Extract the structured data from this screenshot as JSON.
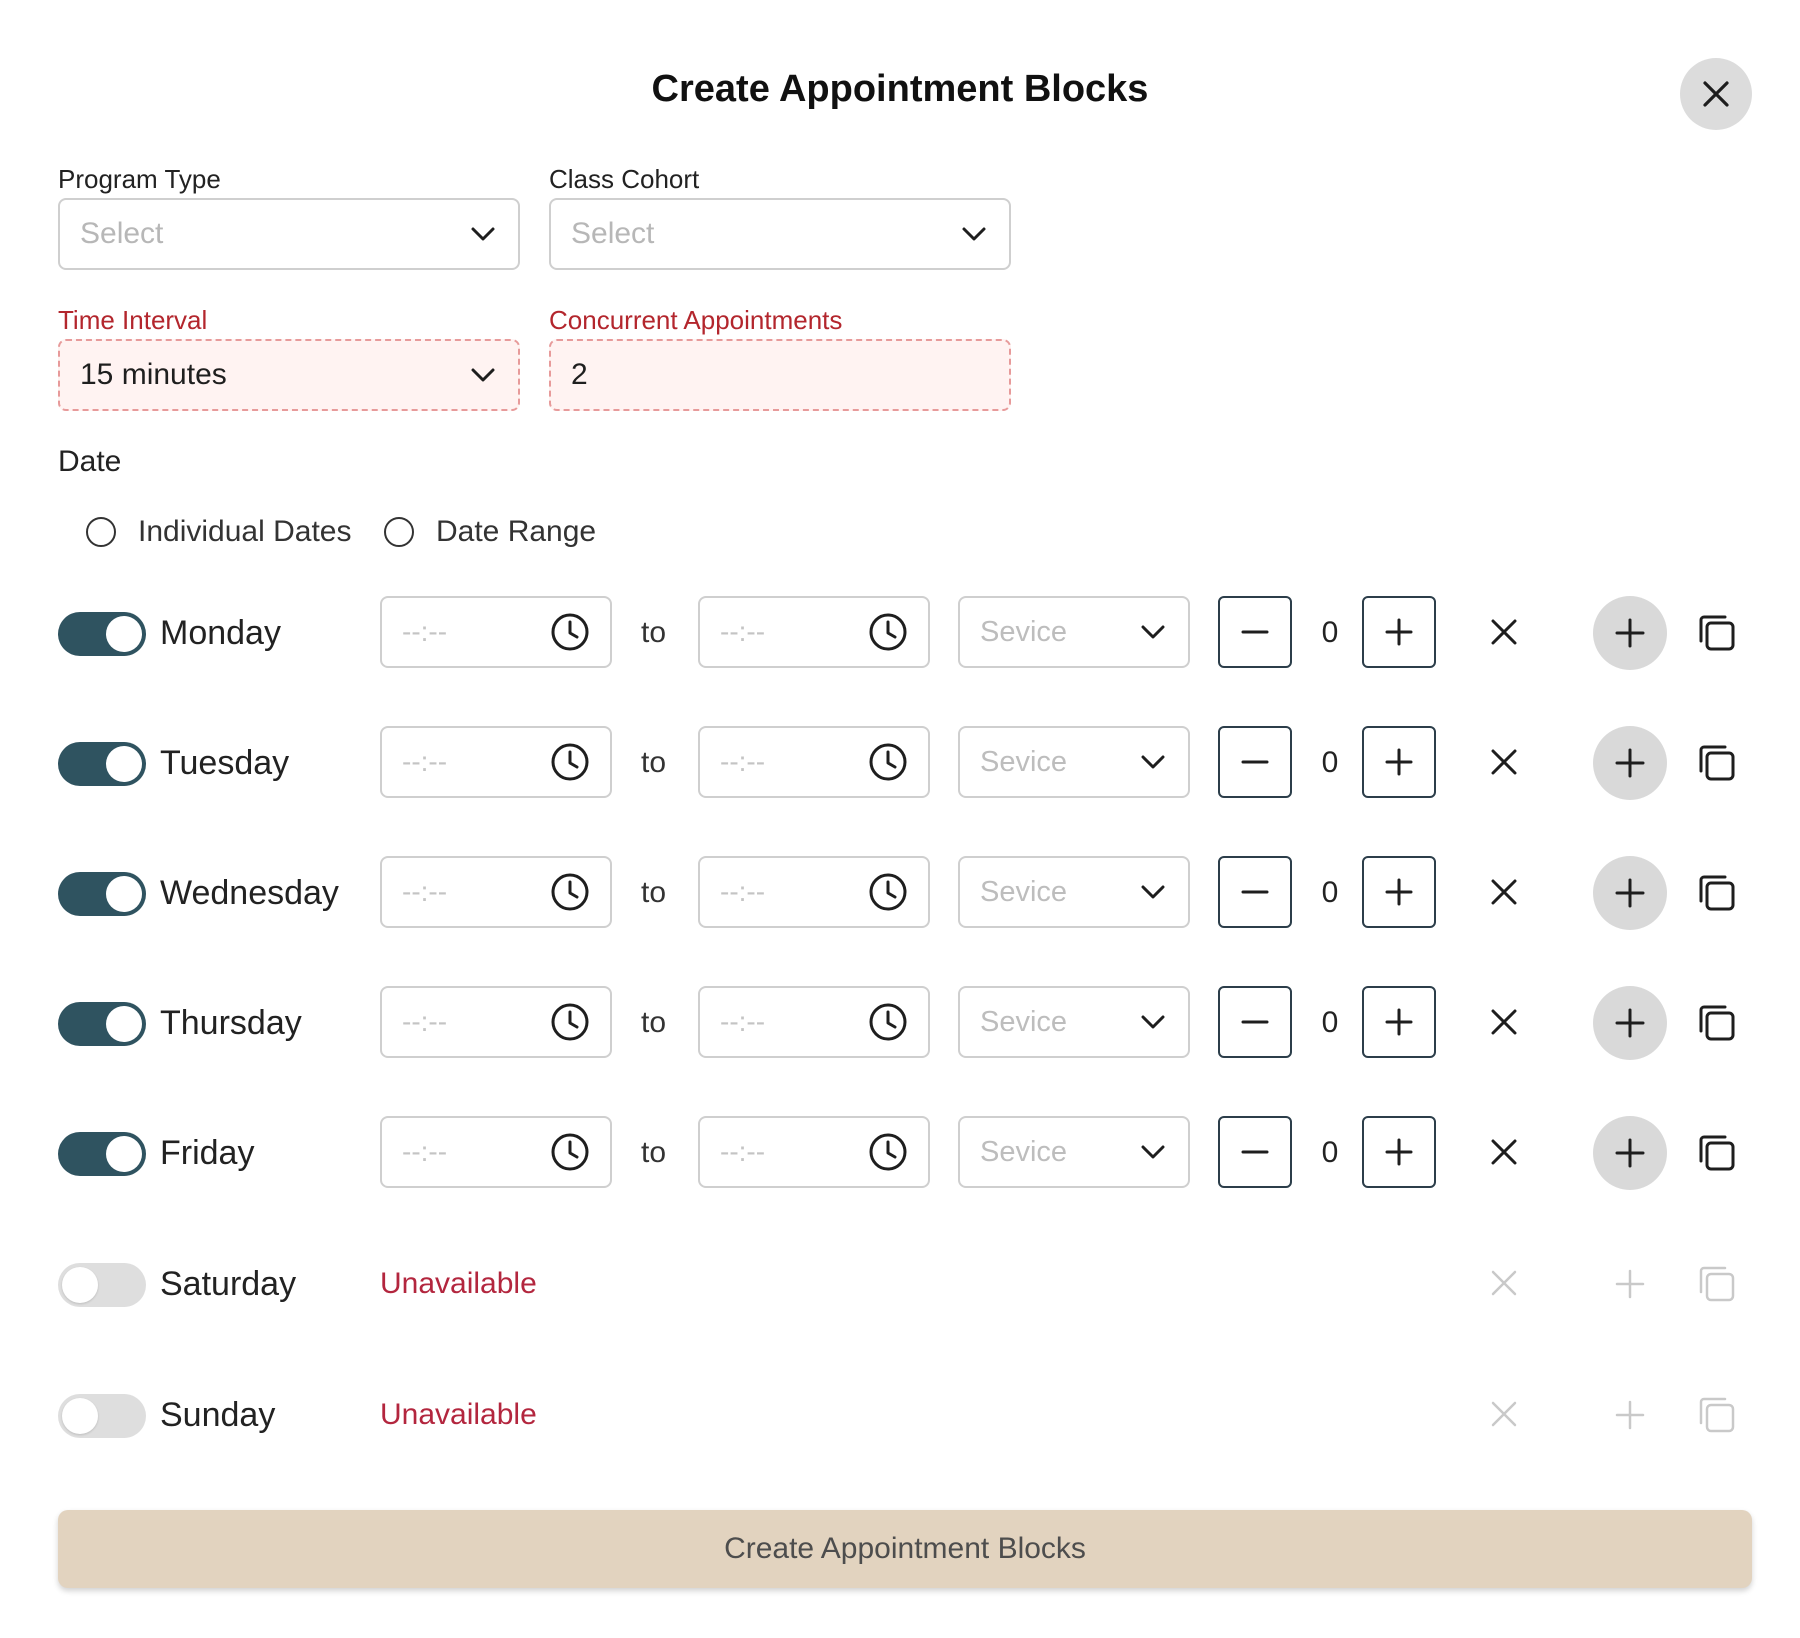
{
  "dialog": {
    "title": "Create Appointment Blocks",
    "close_icon": "close-icon"
  },
  "form": {
    "program_type": {
      "label": "Program Type",
      "placeholder": "Select"
    },
    "class_cohort": {
      "label": "Class Cohort",
      "placeholder": "Select"
    },
    "time_interval": {
      "label": "Time Interval",
      "value": "15 minutes"
    },
    "concurrent_appointments": {
      "label": "Concurrent Appointments",
      "value": "2"
    }
  },
  "date": {
    "label": "Date",
    "options": [
      {
        "label": "Individual Dates",
        "selected": false
      },
      {
        "label": "Date Range",
        "selected": false
      }
    ]
  },
  "schedule": {
    "to_label": "to",
    "time_placeholder": "--:--",
    "service_placeholder": "Sevice",
    "unavailable_label": "Unavailable",
    "days": [
      {
        "name": "Monday",
        "enabled": true,
        "start": "--:--",
        "end": "--:--",
        "service": "Sevice",
        "count": "0"
      },
      {
        "name": "Tuesday",
        "enabled": true,
        "start": "--:--",
        "end": "--:--",
        "service": "Sevice",
        "count": "0"
      },
      {
        "name": "Wednesday",
        "enabled": true,
        "start": "--:--",
        "end": "--:--",
        "service": "Sevice",
        "count": "0"
      },
      {
        "name": "Thursday",
        "enabled": true,
        "start": "--:--",
        "end": "--:--",
        "service": "Sevice",
        "count": "0"
      },
      {
        "name": "Friday",
        "enabled": true,
        "start": "--:--",
        "end": "--:--",
        "service": "Sevice",
        "count": "0"
      },
      {
        "name": "Saturday",
        "enabled": false,
        "status": "Unavailable"
      },
      {
        "name": "Sunday",
        "enabled": false,
        "status": "Unavailable"
      }
    ]
  },
  "submit": {
    "label": "Create Appointment Blocks"
  },
  "colors": {
    "toggle_on": "#2f5360",
    "toggle_off": "#dedede",
    "error_label": "#b3262d",
    "unavailable": "#b3263e",
    "submit_bg": "#e2d3bf"
  }
}
